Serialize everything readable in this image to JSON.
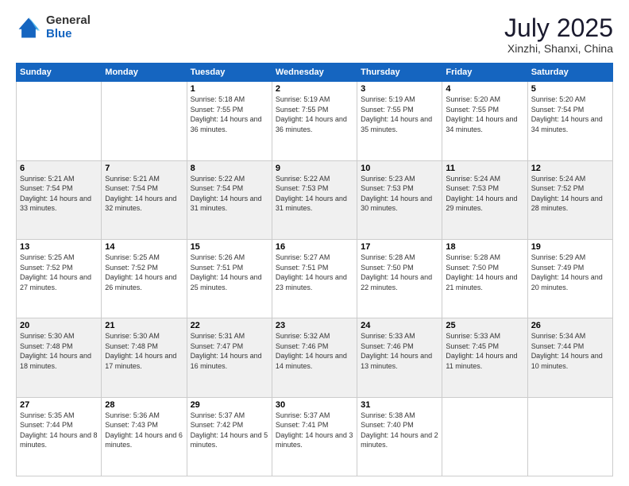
{
  "logo": {
    "general": "General",
    "blue": "Blue"
  },
  "header": {
    "month": "July 2025",
    "location": "Xinzhi, Shanxi, China"
  },
  "weekdays": [
    "Sunday",
    "Monday",
    "Tuesday",
    "Wednesday",
    "Thursday",
    "Friday",
    "Saturday"
  ],
  "weeks": [
    [
      {
        "day": "",
        "sunrise": "",
        "sunset": "",
        "daylight": ""
      },
      {
        "day": "",
        "sunrise": "",
        "sunset": "",
        "daylight": ""
      },
      {
        "day": "1",
        "sunrise": "Sunrise: 5:18 AM",
        "sunset": "Sunset: 7:55 PM",
        "daylight": "Daylight: 14 hours and 36 minutes."
      },
      {
        "day": "2",
        "sunrise": "Sunrise: 5:19 AM",
        "sunset": "Sunset: 7:55 PM",
        "daylight": "Daylight: 14 hours and 36 minutes."
      },
      {
        "day": "3",
        "sunrise": "Sunrise: 5:19 AM",
        "sunset": "Sunset: 7:55 PM",
        "daylight": "Daylight: 14 hours and 35 minutes."
      },
      {
        "day": "4",
        "sunrise": "Sunrise: 5:20 AM",
        "sunset": "Sunset: 7:55 PM",
        "daylight": "Daylight: 14 hours and 34 minutes."
      },
      {
        "day": "5",
        "sunrise": "Sunrise: 5:20 AM",
        "sunset": "Sunset: 7:54 PM",
        "daylight": "Daylight: 14 hours and 34 minutes."
      }
    ],
    [
      {
        "day": "6",
        "sunrise": "Sunrise: 5:21 AM",
        "sunset": "Sunset: 7:54 PM",
        "daylight": "Daylight: 14 hours and 33 minutes."
      },
      {
        "day": "7",
        "sunrise": "Sunrise: 5:21 AM",
        "sunset": "Sunset: 7:54 PM",
        "daylight": "Daylight: 14 hours and 32 minutes."
      },
      {
        "day": "8",
        "sunrise": "Sunrise: 5:22 AM",
        "sunset": "Sunset: 7:54 PM",
        "daylight": "Daylight: 14 hours and 31 minutes."
      },
      {
        "day": "9",
        "sunrise": "Sunrise: 5:22 AM",
        "sunset": "Sunset: 7:53 PM",
        "daylight": "Daylight: 14 hours and 31 minutes."
      },
      {
        "day": "10",
        "sunrise": "Sunrise: 5:23 AM",
        "sunset": "Sunset: 7:53 PM",
        "daylight": "Daylight: 14 hours and 30 minutes."
      },
      {
        "day": "11",
        "sunrise": "Sunrise: 5:24 AM",
        "sunset": "Sunset: 7:53 PM",
        "daylight": "Daylight: 14 hours and 29 minutes."
      },
      {
        "day": "12",
        "sunrise": "Sunrise: 5:24 AM",
        "sunset": "Sunset: 7:52 PM",
        "daylight": "Daylight: 14 hours and 28 minutes."
      }
    ],
    [
      {
        "day": "13",
        "sunrise": "Sunrise: 5:25 AM",
        "sunset": "Sunset: 7:52 PM",
        "daylight": "Daylight: 14 hours and 27 minutes."
      },
      {
        "day": "14",
        "sunrise": "Sunrise: 5:25 AM",
        "sunset": "Sunset: 7:52 PM",
        "daylight": "Daylight: 14 hours and 26 minutes."
      },
      {
        "day": "15",
        "sunrise": "Sunrise: 5:26 AM",
        "sunset": "Sunset: 7:51 PM",
        "daylight": "Daylight: 14 hours and 25 minutes."
      },
      {
        "day": "16",
        "sunrise": "Sunrise: 5:27 AM",
        "sunset": "Sunset: 7:51 PM",
        "daylight": "Daylight: 14 hours and 23 minutes."
      },
      {
        "day": "17",
        "sunrise": "Sunrise: 5:28 AM",
        "sunset": "Sunset: 7:50 PM",
        "daylight": "Daylight: 14 hours and 22 minutes."
      },
      {
        "day": "18",
        "sunrise": "Sunrise: 5:28 AM",
        "sunset": "Sunset: 7:50 PM",
        "daylight": "Daylight: 14 hours and 21 minutes."
      },
      {
        "day": "19",
        "sunrise": "Sunrise: 5:29 AM",
        "sunset": "Sunset: 7:49 PM",
        "daylight": "Daylight: 14 hours and 20 minutes."
      }
    ],
    [
      {
        "day": "20",
        "sunrise": "Sunrise: 5:30 AM",
        "sunset": "Sunset: 7:48 PM",
        "daylight": "Daylight: 14 hours and 18 minutes."
      },
      {
        "day": "21",
        "sunrise": "Sunrise: 5:30 AM",
        "sunset": "Sunset: 7:48 PM",
        "daylight": "Daylight: 14 hours and 17 minutes."
      },
      {
        "day": "22",
        "sunrise": "Sunrise: 5:31 AM",
        "sunset": "Sunset: 7:47 PM",
        "daylight": "Daylight: 14 hours and 16 minutes."
      },
      {
        "day": "23",
        "sunrise": "Sunrise: 5:32 AM",
        "sunset": "Sunset: 7:46 PM",
        "daylight": "Daylight: 14 hours and 14 minutes."
      },
      {
        "day": "24",
        "sunrise": "Sunrise: 5:33 AM",
        "sunset": "Sunset: 7:46 PM",
        "daylight": "Daylight: 14 hours and 13 minutes."
      },
      {
        "day": "25",
        "sunrise": "Sunrise: 5:33 AM",
        "sunset": "Sunset: 7:45 PM",
        "daylight": "Daylight: 14 hours and 11 minutes."
      },
      {
        "day": "26",
        "sunrise": "Sunrise: 5:34 AM",
        "sunset": "Sunset: 7:44 PM",
        "daylight": "Daylight: 14 hours and 10 minutes."
      }
    ],
    [
      {
        "day": "27",
        "sunrise": "Sunrise: 5:35 AM",
        "sunset": "Sunset: 7:44 PM",
        "daylight": "Daylight: 14 hours and 8 minutes."
      },
      {
        "day": "28",
        "sunrise": "Sunrise: 5:36 AM",
        "sunset": "Sunset: 7:43 PM",
        "daylight": "Daylight: 14 hours and 6 minutes."
      },
      {
        "day": "29",
        "sunrise": "Sunrise: 5:37 AM",
        "sunset": "Sunset: 7:42 PM",
        "daylight": "Daylight: 14 hours and 5 minutes."
      },
      {
        "day": "30",
        "sunrise": "Sunrise: 5:37 AM",
        "sunset": "Sunset: 7:41 PM",
        "daylight": "Daylight: 14 hours and 3 minutes."
      },
      {
        "day": "31",
        "sunrise": "Sunrise: 5:38 AM",
        "sunset": "Sunset: 7:40 PM",
        "daylight": "Daylight: 14 hours and 2 minutes."
      },
      {
        "day": "",
        "sunrise": "",
        "sunset": "",
        "daylight": ""
      },
      {
        "day": "",
        "sunrise": "",
        "sunset": "",
        "daylight": ""
      }
    ]
  ]
}
